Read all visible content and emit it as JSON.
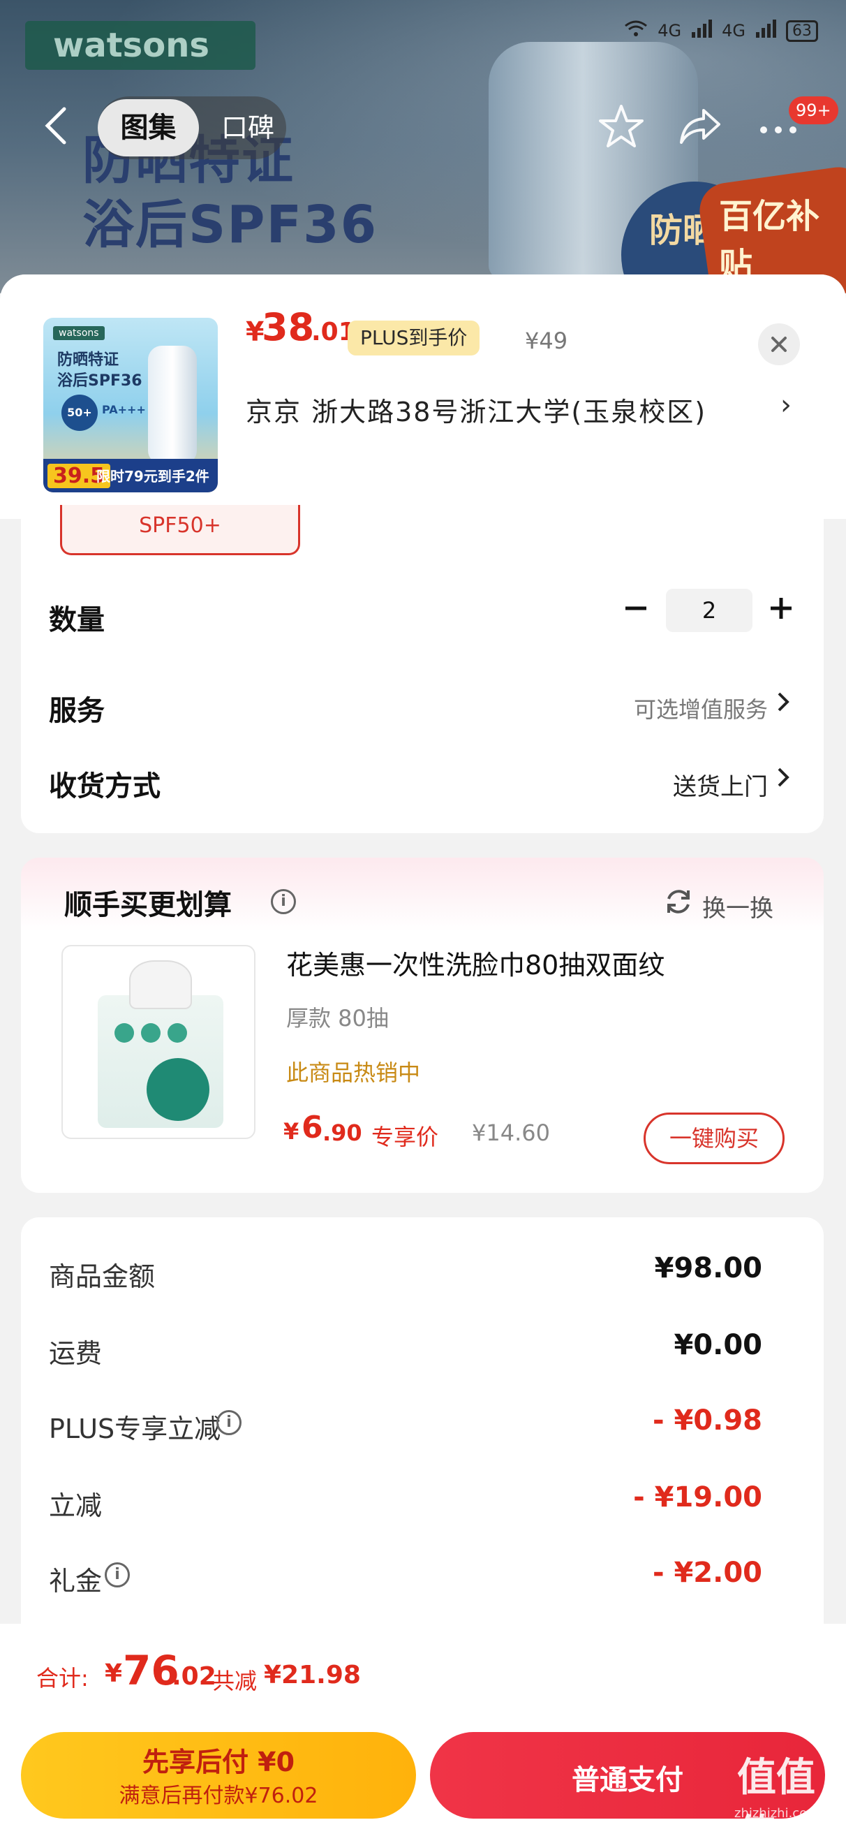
{
  "background": {
    "logo": "watsons",
    "headline_line1": "防晒特证",
    "headline_line2": "浴后SPF36",
    "badge1": "防晒特证",
    "badge2": "百亿补贴"
  },
  "status_bar": {
    "network1": "4G",
    "network2": "4G",
    "battery": "63"
  },
  "nav": {
    "back_icon": "back-arrow-icon",
    "tab_gallery": "图集",
    "tab_reviews": "口碑",
    "more_badge": "99+"
  },
  "product": {
    "thumb_logo": "watsons",
    "thumb_line1": "防晒特证",
    "thumb_line2": "浴后SPF36",
    "thumb_spf": "50+",
    "thumb_pa": "PA+++",
    "thumb_price": "39.5",
    "thumb_promo": "限时79元到手2件",
    "price_symbol": "¥",
    "price_int": "38",
    "price_dec": ".01",
    "plus_tag": "PLUS到手价",
    "original_price": "¥49",
    "address": "京京   浙大路38号浙江大学(玉泉校区)",
    "address_arrow": "›"
  },
  "spec": {
    "selected_chip": "SPF50+",
    "quantity_label": "数量",
    "quantity_value": "2",
    "service_label": "服务",
    "service_value": "可选增值服务",
    "delivery_label": "收货方式",
    "delivery_value": "送货上门"
  },
  "recommend": {
    "title": "顺手买更划算",
    "swap_label": "换一换",
    "item_name": "花美惠一次性洗脸巾80抽双面纹",
    "item_spec": "厚款  80抽",
    "item_hot": "此商品热销中",
    "price_symbol": "¥",
    "price_int": "6",
    "price_dec": ".90",
    "price_tag": "专享价",
    "original_price": "¥14.60",
    "buy_button": "一键购买"
  },
  "summary": {
    "rows": [
      {
        "label": "商品金额",
        "value": "¥98.00"
      },
      {
        "label": "运费",
        "value": "¥0.00"
      },
      {
        "label": "PLUS专享立减",
        "value": "- ¥0.98"
      },
      {
        "label": "立减",
        "value": "- ¥19.00"
      },
      {
        "label": "礼金",
        "value": "- ¥2.00"
      }
    ]
  },
  "footer": {
    "total_label": "合计:",
    "total_symbol": "¥",
    "total_int": "76",
    "total_dec": ".02",
    "saving_label": "共减",
    "saving_value": "¥21.98",
    "pay_later_title": "先享后付 ¥0",
    "pay_later_sub": "满意后再付款¥76.02",
    "pay_normal": "普通支付",
    "watermark": "值值值",
    "watermark_url": "zhizhizhi.com"
  },
  "colors": {
    "accent_red": "#e02a1c",
    "pay_yellow": "#ffc81e",
    "pay_red": "#f03447",
    "hot_gold": "#c88a15"
  }
}
